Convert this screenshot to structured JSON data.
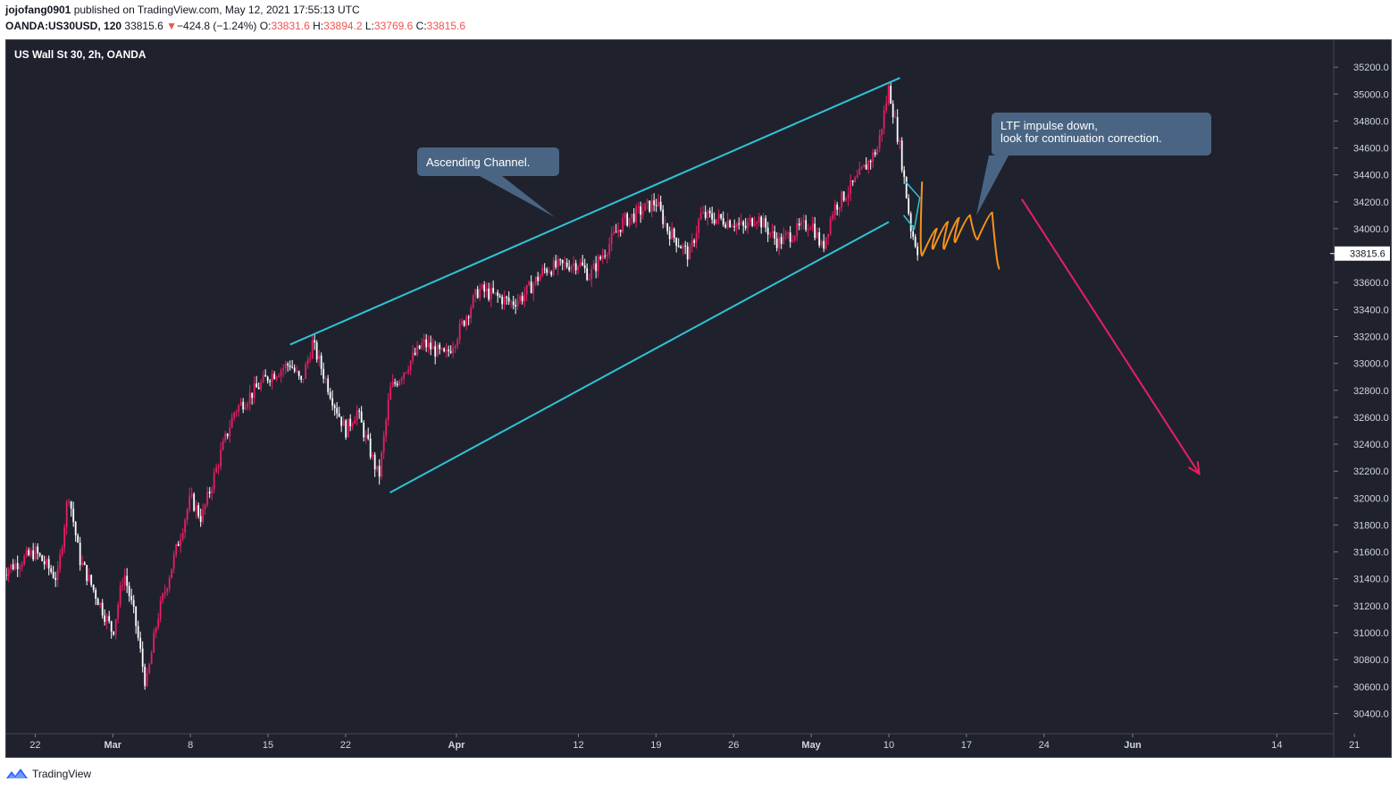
{
  "header": {
    "author": "jojofang0901",
    "published_text": "published on TradingView.com, May 12, 2021 17:55:13 UTC",
    "symbol": "OANDA:US30USD, 120",
    "last_price": "33815.6",
    "change_arrow": "▼",
    "change": "−424.8 (−1.24%)",
    "o_label": "O:",
    "o_value": "33831.6",
    "h_label": "H:",
    "h_value": "33894.2",
    "l_label": "L:",
    "l_value": "33769.6",
    "c_label": "C:",
    "c_value": "33815.6"
  },
  "footer": {
    "brand": "TradingView",
    "logo_icon": "tradingview-logo-icon"
  },
  "chart_data": {
    "type": "candlestick",
    "title": "US Wall St 30, 2h, OANDA",
    "x_axis": {
      "ticks": [
        "22",
        "Mar",
        "8",
        "15",
        "22",
        "Apr",
        "12",
        "19",
        "26",
        "May",
        "10",
        "17",
        "24",
        "Jun",
        "14",
        "21"
      ],
      "bold_ticks": [
        "Mar",
        "Apr",
        "May",
        "Jun"
      ]
    },
    "y_axis": {
      "min": 30250,
      "max": 35400,
      "ticks": [
        35200,
        35000,
        34800,
        34600,
        34400,
        34200,
        34000,
        33800,
        33600,
        33400,
        33200,
        33000,
        32800,
        32600,
        32400,
        32200,
        32000,
        31800,
        31600,
        31400,
        31200,
        31000,
        30800,
        30600,
        30400
      ],
      "tick_decimals": 1,
      "grid": false
    },
    "last_price_label": "33815.6",
    "price_path": [
      {
        "t": "2021-02-19",
        "v": 31450
      },
      {
        "t": "2021-02-22",
        "v": 31600
      },
      {
        "t": "2021-02-24",
        "v": 31400
      },
      {
        "t": "2021-02-25",
        "v": 32050
      },
      {
        "t": "2021-02-26",
        "v": 31550
      },
      {
        "t": "2021-03-01",
        "v": 31000
      },
      {
        "t": "2021-03-02",
        "v": 31450
      },
      {
        "t": "2021-03-03",
        "v": 31100
      },
      {
        "t": "2021-03-04",
        "v": 30600
      },
      {
        "t": "2021-03-05",
        "v": 31100
      },
      {
        "t": "2021-03-08",
        "v": 32000
      },
      {
        "t": "2021-03-09",
        "v": 31850
      },
      {
        "t": "2021-03-11",
        "v": 32400
      },
      {
        "t": "2021-03-12",
        "v": 32650
      },
      {
        "t": "2021-03-15",
        "v": 32900
      },
      {
        "t": "2021-03-17",
        "v": 33000
      },
      {
        "t": "2021-03-18",
        "v": 32850
      },
      {
        "t": "2021-03-19",
        "v": 33150
      },
      {
        "t": "2021-03-21",
        "v": 32700
      },
      {
        "t": "2021-03-22",
        "v": 32500
      },
      {
        "t": "2021-03-23",
        "v": 32650
      },
      {
        "t": "2021-03-24",
        "v": 32400
      },
      {
        "t": "2021-03-25",
        "v": 32150
      },
      {
        "t": "2021-03-26",
        "v": 32800
      },
      {
        "t": "2021-03-29",
        "v": 33150
      },
      {
        "t": "2021-03-31",
        "v": 33050
      },
      {
        "t": "2021-04-01",
        "v": 33200
      },
      {
        "t": "2021-04-03",
        "v": 33550
      },
      {
        "t": "2021-04-06",
        "v": 33450
      },
      {
        "t": "2021-04-07",
        "v": 33500
      },
      {
        "t": "2021-04-09",
        "v": 33700
      },
      {
        "t": "2021-04-12",
        "v": 33750
      },
      {
        "t": "2021-04-13",
        "v": 33650
      },
      {
        "t": "2021-04-16",
        "v": 34050
      },
      {
        "t": "2021-04-19",
        "v": 34200
      },
      {
        "t": "2021-04-20",
        "v": 34000
      },
      {
        "t": "2021-04-22",
        "v": 33800
      },
      {
        "t": "2021-04-23",
        "v": 34100
      },
      {
        "t": "2021-04-26",
        "v": 34050
      },
      {
        "t": "2021-04-27",
        "v": 34000
      },
      {
        "t": "2021-04-28",
        "v": 34100
      },
      {
        "t": "2021-04-30",
        "v": 33900
      },
      {
        "t": "2021-05-03",
        "v": 34050
      },
      {
        "t": "2021-05-04",
        "v": 33850
      },
      {
        "t": "2021-05-05",
        "v": 34150
      },
      {
        "t": "2021-05-07",
        "v": 34350
      },
      {
        "t": "2021-05-09",
        "v": 34600
      },
      {
        "t": "2021-05-10",
        "v": 35050
      },
      {
        "t": "2021-05-11",
        "v": 34600
      },
      {
        "t": "2021-05-11T12:00",
        "v": 34300
      },
      {
        "t": "2021-05-12",
        "v": 34000
      },
      {
        "t": "2021-05-12T17:00",
        "v": 33815.6
      }
    ],
    "annotations": {
      "channel_upper": {
        "from": {
          "t": "2021-03-17",
          "v": 33140
        },
        "to": {
          "t": "2021-05-11",
          "v": 35120
        },
        "color": "#2fc4d6"
      },
      "channel_lower": {
        "from": {
          "t": "2021-03-26",
          "v": 32040
        },
        "to": {
          "t": "2021-05-10",
          "v": 34050
        },
        "color": "#2fc4d6"
      },
      "projection_path": {
        "points": [
          {
            "t": "2021-05-13",
            "v": 34350
          },
          {
            "t": "2021-05-13",
            "v": 33800
          },
          {
            "t": "2021-05-14",
            "v": 34000
          },
          {
            "t": "2021-05-14",
            "v": 33850
          },
          {
            "t": "2021-05-15",
            "v": 34050
          },
          {
            "t": "2021-05-15",
            "v": 33850
          },
          {
            "t": "2021-05-16",
            "v": 34080
          },
          {
            "t": "2021-05-16",
            "v": 33900
          },
          {
            "t": "2021-05-17",
            "v": 34100
          },
          {
            "t": "2021-05-18",
            "v": 33920
          },
          {
            "t": "2021-05-19",
            "v": 34120
          },
          {
            "t": "2021-05-20",
            "v": 33700
          }
        ],
        "color": "#f7931a"
      },
      "target_arrow": {
        "from": {
          "t": "2021-05-22",
          "v": 34220
        },
        "to": {
          "t": "2021-06-07",
          "v": 32180
        },
        "color": "#e91e63"
      },
      "impulse_wedge": {
        "color": "#2fc4d6"
      },
      "callouts": [
        {
          "lines": [
            "Ascending Channel."
          ]
        },
        {
          "lines": [
            "LTF impulse down,",
            "look for continuation correction."
          ]
        }
      ]
    },
    "colors": {
      "background": "#1f222d",
      "up_candle": "#e91e63",
      "down_candle": "#ffffff",
      "callout_bg": "#4a6583"
    }
  }
}
